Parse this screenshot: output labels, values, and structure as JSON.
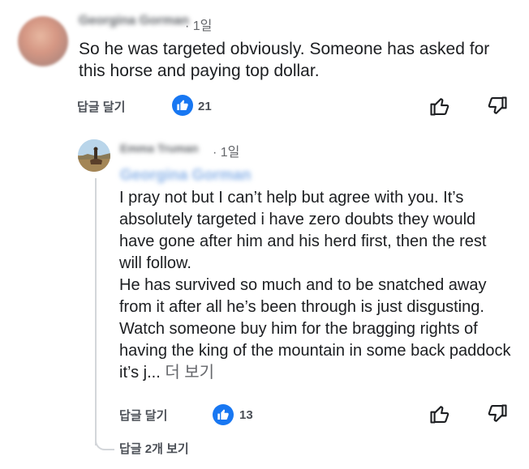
{
  "comment": {
    "author": "Georgina Gorman",
    "time": "· 1일",
    "text": "So he was targeted obviously. Someone has asked for this horse and paying top dollar.",
    "reply_label": "답글 달기",
    "like_count": "21"
  },
  "reply": {
    "author": "Emma Truman",
    "time": "· 1일",
    "mention": "Georgina Gorman",
    "text": "I pray not but I can’t help but agree with you. It’s absolutely targeted i have zero doubts they would have gone after him and his herd first, then the rest will follow.\nHe has survived so much and to be snatched away from it after all he’s been through is just disgusting. Watch someone buy him for the bragging rights of having the king of the mountain in some back paddock it’s j...",
    "more_label": "더 보기",
    "reply_label": "답글 달기",
    "like_count": "13",
    "view_replies_label": "답글 2개 보기"
  },
  "colors": {
    "like_blue": "#1877f2",
    "secondary_text": "#65676b",
    "thread_line": "#d3d6da"
  },
  "icons": {
    "like_badge": "thumbs-up-badge-icon",
    "like": "thumbs-up-outline-icon",
    "dislike": "thumbs-down-outline-icon"
  }
}
